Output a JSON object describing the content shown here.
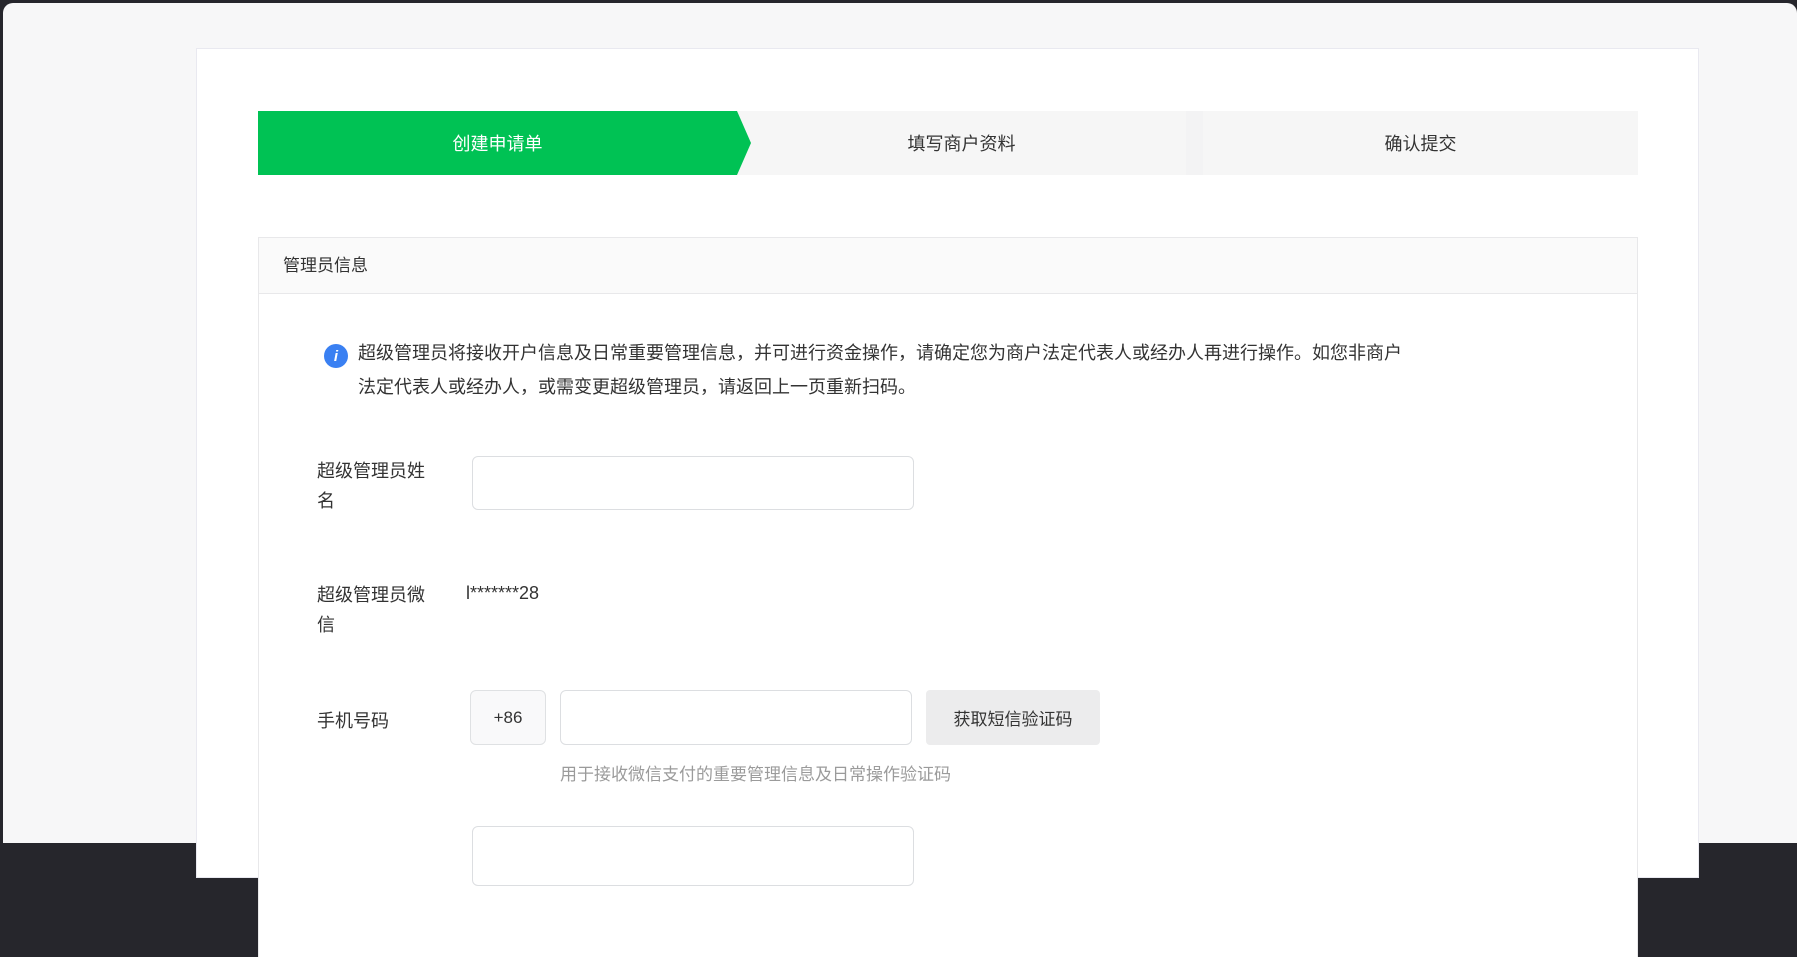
{
  "colors": {
    "accent-green": "#00c254",
    "info-blue": "#3a80f2"
  },
  "steps": [
    {
      "label": "创建申请单",
      "state": "active"
    },
    {
      "label": "填写商户资料",
      "state": "inactive"
    },
    {
      "label": "确认提交",
      "state": "inactive"
    }
  ],
  "section": {
    "title": "管理员信息",
    "notice": {
      "icon": "info-icon",
      "icon_glyph": "i",
      "line1": "超级管理员将接收开户信息及日常重要管理信息，并可进行资金操作，请确定您为商户法定代表人或经办人再进行操作。如您非商户",
      "line2": "法定代表人或经办人，或需变更超级管理员，请返回上一页重新扫码。"
    },
    "fields": {
      "admin_name": {
        "label": "超级管理员姓名",
        "value": "",
        "placeholder": ""
      },
      "admin_wechat": {
        "label": "超级管理员微信",
        "value": "l*******28"
      },
      "phone": {
        "label": "手机号码",
        "country_code": "+86",
        "value": "",
        "placeholder": "",
        "sms_button_label": "获取短信验证码",
        "helper": "用于接收微信支付的重要管理信息及日常操作验证码"
      }
    }
  }
}
